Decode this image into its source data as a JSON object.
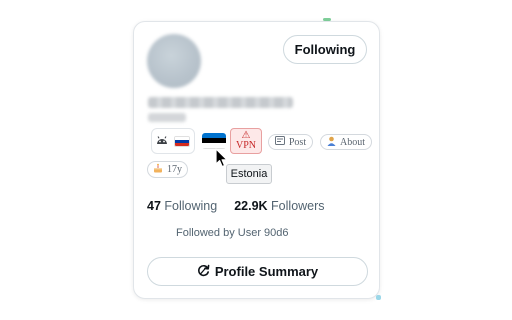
{
  "profile": {
    "follow_button_label": "Following",
    "chips": {
      "country_tooltip": "Estonia",
      "vpn_warning_glyph": "⚠",
      "vpn_label": "VPN",
      "post_icon": "post-icon",
      "post_label": "Post",
      "about_icon": "person-icon",
      "about_label": "About",
      "age_icon": "cake-icon",
      "age_label": "17y"
    },
    "stats": {
      "following_count": "47",
      "following_label": "Following",
      "followers_count": "22.9K",
      "followers_label": "Followers"
    },
    "followed_by": "Followed by User 90d6",
    "summary_button_label": "Profile Summary"
  },
  "colors": {
    "vpn_background": "#fde8e8",
    "vpn_text": "#c62828",
    "estonia_flag": [
      "#0072ce",
      "#000000",
      "#ffffff"
    ],
    "russia_flag": [
      "#ffffff",
      "#0039a6",
      "#d52b1e"
    ]
  }
}
